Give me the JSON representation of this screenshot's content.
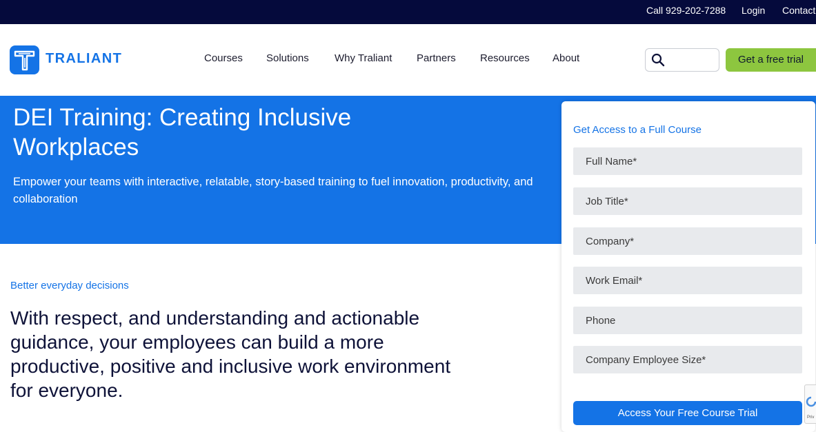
{
  "topbar": {
    "phone": "Call 929-202-7288",
    "login": "Login",
    "contact": "Contact"
  },
  "header": {
    "logo_text": "TRALIANT",
    "nav": [
      "Courses",
      "Solutions",
      "Why Traliant",
      "Partners",
      "Resources",
      "About"
    ],
    "search_placeholder": "",
    "trial_label": "Get a free trial"
  },
  "hero": {
    "title": "DEI Training: Creating Inclusive Workplaces",
    "subtitle": "Empower your teams with interactive, relatable, story-based training to fuel innovation, productivity, and collaboration"
  },
  "content": {
    "eyebrow": "Better everyday decisions",
    "lead": "With respect, and understanding and actionable guidance, your employees can build a more productive, positive and inclusive work environment for everyone."
  },
  "form": {
    "heading": "Get Access to a Full Course",
    "fields": [
      "Full Name*",
      "Job Title*",
      "Company*",
      "Work Email*",
      "Phone",
      "Company Employee Size*"
    ],
    "submit_label": "Access Your Free Course Trial"
  },
  "recaptcha": {
    "text": "Priv"
  },
  "colors": {
    "topbar": "#050a3c",
    "brand_blue": "#1473e6",
    "trial_green": "#8dc63f",
    "field_bg": "#e8eaed",
    "headline_navy": "#0e1238"
  }
}
